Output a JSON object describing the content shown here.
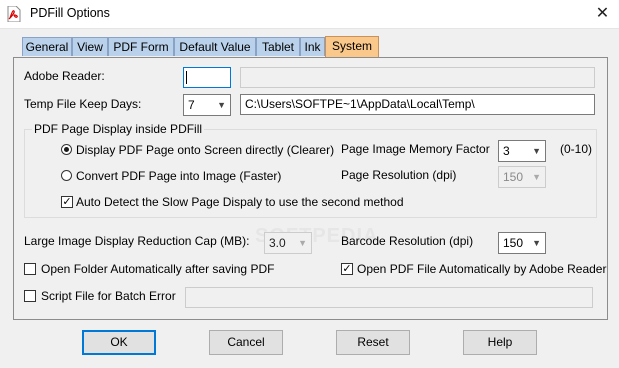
{
  "window": {
    "title": "PDFill Options",
    "close_glyph": "✕",
    "app_icon": "pdf-icon"
  },
  "tabs": [
    {
      "label": "General",
      "active": false
    },
    {
      "label": "View",
      "active": false
    },
    {
      "label": "PDF Form",
      "active": false
    },
    {
      "label": "Default Value",
      "active": false
    },
    {
      "label": "Tablet",
      "active": false
    },
    {
      "label": "Ink",
      "active": false
    },
    {
      "label": "System",
      "active": true
    }
  ],
  "system": {
    "adobe_reader_label": "Adobe Reader:",
    "adobe_reader_value": "",
    "adobe_reader_path": "",
    "temp_days_label": "Temp File Keep Days:",
    "temp_days_value": "7",
    "temp_path": "C:\\Users\\SOFTPE~1\\AppData\\Local\\Temp\\",
    "group_title": "PDF Page Display inside PDFill",
    "radio_screen": "Display PDF Page onto Screen directly (Clearer)",
    "radio_image": "Convert PDF Page into Image (Faster)",
    "auto_detect": "Auto Detect the Slow Page Dispaly to use the second method",
    "memory_factor_label": "Page Image Memory Factor",
    "memory_factor_value": "3",
    "memory_factor_range": "(0-10)",
    "resolution_label": "Page Resolution (dpi)",
    "resolution_value": "150",
    "reduction_cap_label": "Large Image Display Reduction Cap (MB):",
    "reduction_cap_value": "3.0",
    "barcode_label": "Barcode Resolution (dpi)",
    "barcode_value": "150",
    "open_folder_label": "Open Folder Automatically after saving PDF",
    "open_pdf_label": "Open PDF File Automatically by Adobe Reader",
    "script_label": "Script File for Batch Error",
    "script_value": ""
  },
  "state": {
    "radio_screen_selected": true,
    "radio_image_selected": false,
    "auto_detect_checked": true,
    "open_folder_checked": false,
    "open_pdf_checked": true,
    "script_checked": false
  },
  "buttons": {
    "ok": "OK",
    "cancel": "Cancel",
    "reset": "Reset",
    "help": "Help"
  },
  "watermark": "SOFTPEDIA",
  "check_glyph": "✓",
  "dropdown_glyph": "▼"
}
